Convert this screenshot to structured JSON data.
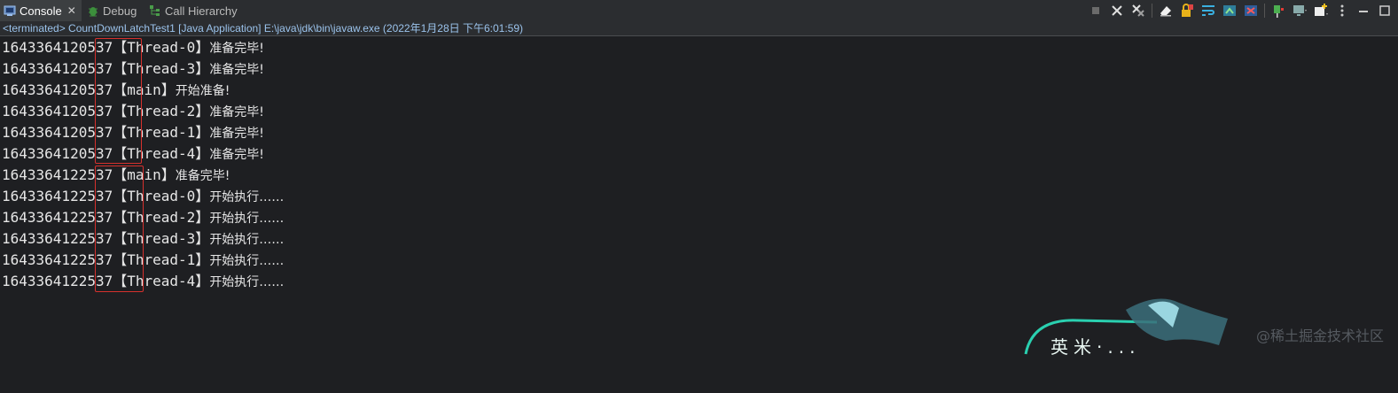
{
  "tabs": [
    {
      "label": "Console",
      "active": true,
      "icon": "console-icon"
    },
    {
      "label": "Debug",
      "active": false,
      "icon": "bug-icon"
    },
    {
      "label": "Call Hierarchy",
      "active": false,
      "icon": "hierarchy-icon"
    }
  ],
  "toolbar": {
    "icons": [
      "stop-icon",
      "remove-launch-icon",
      "remove-all-terminated-icon",
      "clear-console-icon",
      "scroll-lock-icon",
      "word-wrap-icon",
      "show-on-stdout-icon",
      "show-on-stderr-icon",
      "pin-console-icon",
      "display-console-icon",
      "new-console-icon",
      "view-menu-icon",
      "minimize-icon",
      "maximize-icon"
    ]
  },
  "status_text": "<terminated> CountDownLatchTest1 [Java Application] E:\\java\\jdk\\bin\\javaw.exe (2022年1月28日 下午6:01:59)",
  "console_lines": [
    {
      "ts": "1643364120537",
      "thread": "【Thread-0】",
      "msg": "准备完毕!"
    },
    {
      "ts": "1643364120537",
      "thread": "【Thread-3】",
      "msg": "准备完毕!"
    },
    {
      "ts": "1643364120537",
      "thread": "【main】",
      "msg": "开始准备!"
    },
    {
      "ts": "1643364120537",
      "thread": "【Thread-2】",
      "msg": "准备完毕!"
    },
    {
      "ts": "1643364120537",
      "thread": "【Thread-1】",
      "msg": "准备完毕!"
    },
    {
      "ts": "1643364120537",
      "thread": "【Thread-4】",
      "msg": "准备完毕!"
    },
    {
      "ts": "1643364122537",
      "thread": "【main】",
      "msg": "准备完毕!"
    },
    {
      "ts": "1643364122537",
      "thread": "【Thread-0】",
      "msg": "开始执行……"
    },
    {
      "ts": "1643364122537",
      "thread": "【Thread-2】",
      "msg": "开始执行……"
    },
    {
      "ts": "1643364122537",
      "thread": "【Thread-3】",
      "msg": "开始执行……"
    },
    {
      "ts": "1643364122537",
      "thread": "【Thread-1】",
      "msg": "开始执行……"
    },
    {
      "ts": "1643364122537",
      "thread": "【Thread-4】",
      "msg": "开始执行……"
    }
  ],
  "watermark": "@稀土掘金技术社区",
  "badge_text": "英米·...",
  "colors": {
    "highlight": "#d6312d",
    "status": "#9bc3ec",
    "background": "#1e1f22"
  }
}
